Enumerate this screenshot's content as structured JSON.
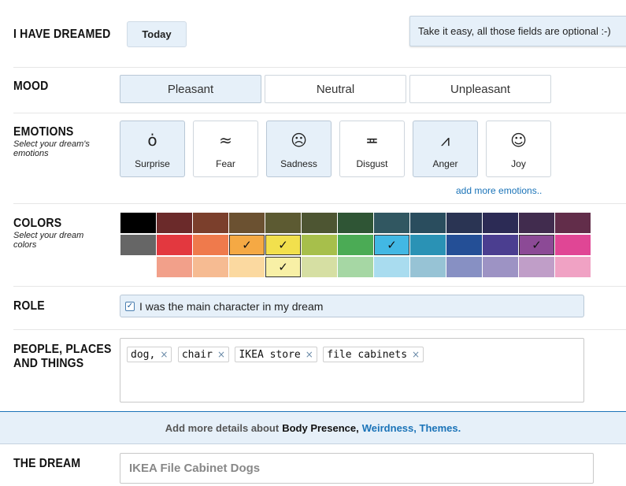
{
  "dreamed": {
    "label": "I HAVE DREAMED",
    "today_button": "Today"
  },
  "tooltip": "Take it easy, all those fields are optional :-)",
  "mood": {
    "label": "MOOD",
    "options": [
      "Pleasant",
      "Neutral",
      "Unpleasant"
    ],
    "selected": "Pleasant"
  },
  "emotions": {
    "label": "EMOTIONS",
    "subtitle": "Select your dream's emotions",
    "items": [
      {
        "name": "Surprise",
        "icon": "surprise-face-icon",
        "face": "ȯ",
        "selected": true
      },
      {
        "name": "Fear",
        "icon": "fear-face-icon",
        "face": "≈",
        "selected": false
      },
      {
        "name": "Sadness",
        "icon": "sadness-face-icon",
        "face": "☹",
        "selected": true
      },
      {
        "name": "Disgust",
        "icon": "disgust-face-icon",
        "face": "≖",
        "selected": false
      },
      {
        "name": "Anger",
        "icon": "anger-face-icon",
        "face": "⩘",
        "selected": true
      },
      {
        "name": "Joy",
        "icon": "joy-face-icon",
        "face": "☺",
        "selected": false
      }
    ],
    "add_more": "add more emotions.."
  },
  "colors": {
    "label": "COLORS",
    "subtitle": "Select your dream colors",
    "rows": [
      [
        {
          "c": "#000000"
        },
        {
          "c": "#6b2a2a"
        },
        {
          "c": "#7b3f2c"
        },
        {
          "c": "#6b5131"
        },
        {
          "c": "#5c5a32"
        },
        {
          "c": "#4d5532"
        },
        {
          "c": "#2f5535"
        },
        {
          "c": "#315761"
        },
        {
          "c": "#2a4d5e"
        },
        {
          "c": "#2a3453"
        },
        {
          "c": "#2c2b55"
        },
        {
          "c": "#412c4e"
        },
        {
          "c": "#622d4a"
        }
      ],
      [
        {
          "c": "#666666"
        },
        {
          "c": "#e3383f"
        },
        {
          "c": "#ef7a4c"
        },
        {
          "c": "#f5a944",
          "checked": true
        },
        {
          "c": "#f2e04d",
          "checked": true
        },
        {
          "c": "#a7bf4b"
        },
        {
          "c": "#4bab55"
        },
        {
          "c": "#42b8e4",
          "checked": true
        },
        {
          "c": "#2a92b5"
        },
        {
          "c": "#244f96"
        },
        {
          "c": "#4b3e90"
        },
        {
          "c": "#8c4a96",
          "checked": true
        },
        {
          "c": "#e04695"
        }
      ],
      [
        {
          "c": ""
        },
        {
          "c": "#f2a08a"
        },
        {
          "c": "#f6bb92"
        },
        {
          "c": "#fbd9a0"
        },
        {
          "c": "#f8f0a6",
          "checked": true
        },
        {
          "c": "#d6dfa3"
        },
        {
          "c": "#a6d7a4"
        },
        {
          "c": "#a9dcef"
        },
        {
          "c": "#97c3d5"
        },
        {
          "c": "#8790c3"
        },
        {
          "c": "#9d93c4"
        },
        {
          "c": "#c09ec8"
        },
        {
          "c": "#f0a2c4"
        }
      ]
    ],
    "check_glyph": "✓"
  },
  "role": {
    "label": "ROLE",
    "checkbox_label": "I was the main character in my dream",
    "checked": true,
    "check_glyph": "✓"
  },
  "people": {
    "label_line1": "PEOPLE, PLACES",
    "label_line2": "AND THINGS",
    "tags": [
      "dog,",
      "chair",
      "IKEA store",
      "file cabinets"
    ],
    "remove_glyph": "×"
  },
  "more_details": {
    "prefix": "Add more details about",
    "body_presence": "Body Presence,",
    "weirdness": "Weirdness,",
    "themes": "Themes."
  },
  "dream": {
    "label": "THE DREAM",
    "title_value": "IKEA File Cabinet Dogs"
  }
}
